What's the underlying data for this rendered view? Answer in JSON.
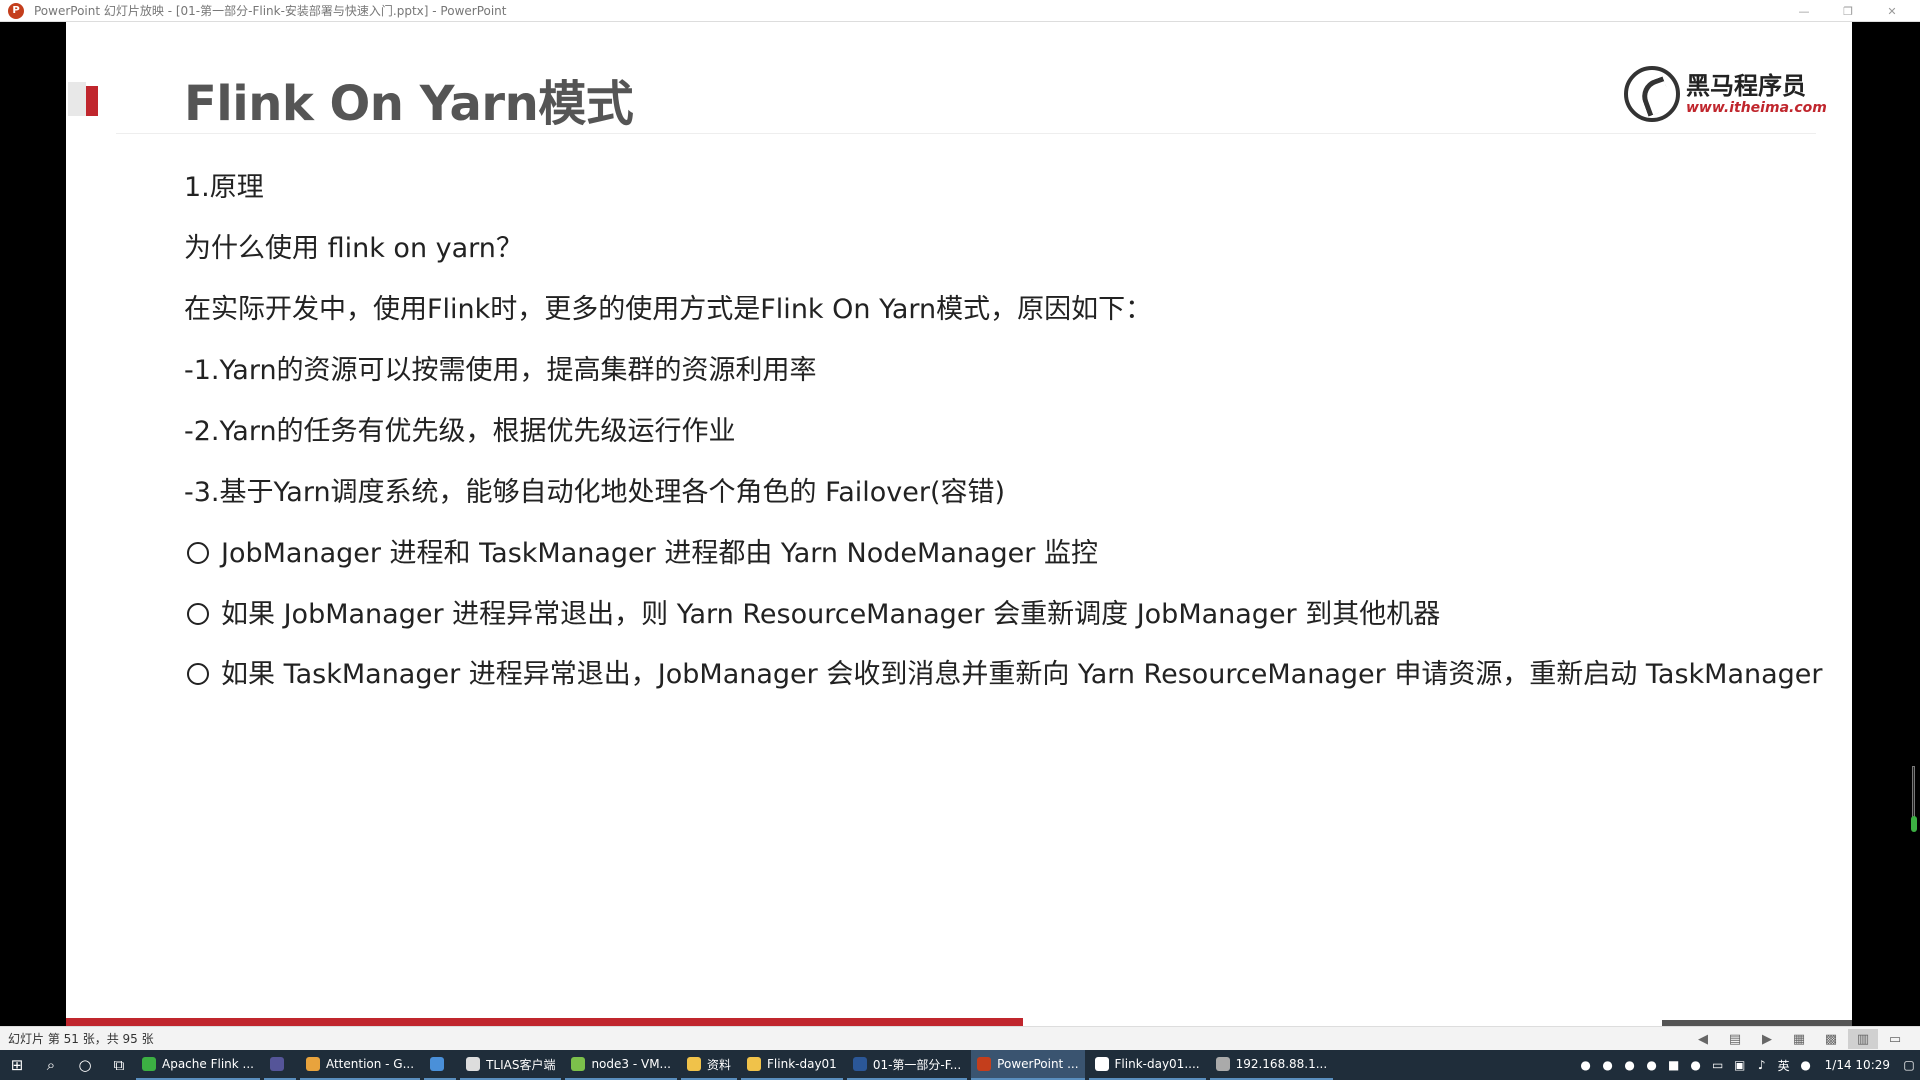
{
  "window": {
    "title": "PowerPoint 幻灯片放映 - [01-第一部分-Flink-安装部署与快速入门.pptx] - PowerPoint",
    "app_icon": "P",
    "controls": [
      "—",
      "❐",
      "✕"
    ]
  },
  "slide": {
    "title": "Flink On Yarn模式",
    "logo": {
      "cn": "黑马程序员",
      "url": "www.itheima.com"
    },
    "lines": [
      "1.原理",
      "为什么使用 flink on yarn？",
      "在实际开发中，使用Flink时，更多的使用方式是Flink On Yarn模式，原因如下：",
      "-1.Yarn的资源可以按需使用，提高集群的资源利用率",
      "-2.Yarn的任务有优先级，根据优先级运行作业",
      "-3.基于Yarn调度系统，能够自动化地处理各个角色的 Failover(容错)"
    ],
    "bullets": [
      "JobManager 进程和 TaskManager 进程都由 Yarn NodeManager 监控",
      "如果 JobManager 进程异常退出，则 Yarn ResourceManager 会重新调度 JobManager 到其他机器",
      "如果 TaskManager 进程异常退出，JobManager 会收到消息并重新向 Yarn ResourceManager 申请资源，重新启动 TaskManager"
    ],
    "progress_fraction": 0.536,
    "accent_color": "#c0262d"
  },
  "status": {
    "slide_info": "幻灯片 第 51 张，共 95 张",
    "views": [
      "◀",
      "▤",
      "▶",
      "▦",
      "▩",
      "▥",
      "▭"
    ]
  },
  "taskbar": {
    "items": [
      {
        "label": "Apache Flink ...",
        "color": "#3cb043"
      },
      {
        "label": "",
        "color": "#555599"
      },
      {
        "label": "Attention - G...",
        "color": "#e8a33d"
      },
      {
        "label": "",
        "color": "#4a90d9"
      },
      {
        "label": "TLIAS客户端",
        "color": "#dddddd"
      },
      {
        "label": "node3 - VM...",
        "color": "#7cc04b"
      },
      {
        "label": "资料",
        "color": "#f0c24a"
      },
      {
        "label": "Flink-day01",
        "color": "#f0c24a"
      },
      {
        "label": "01-第一部分-F...",
        "color": "#2b5797"
      },
      {
        "label": "PowerPoint ...",
        "color": "#c43e1c"
      },
      {
        "label": "Flink-day01....",
        "color": "#ffffff"
      },
      {
        "label": "192.168.88.1...",
        "color": "#aaaaaa"
      }
    ],
    "tray_lang": "英",
    "clock": "1/14 10:29"
  }
}
